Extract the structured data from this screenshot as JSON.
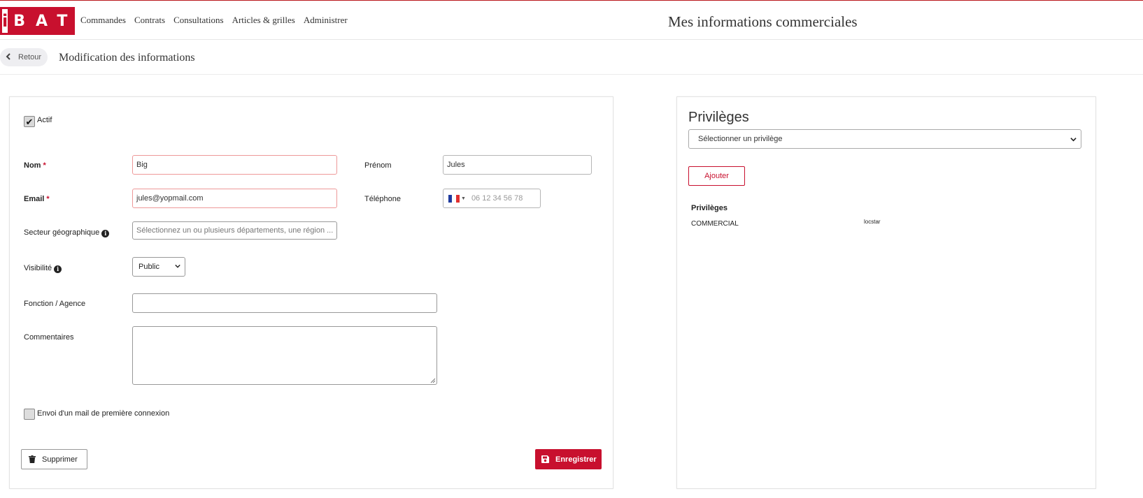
{
  "brand": {
    "logo_first": "i",
    "logo_rest": "BAT",
    "accent": "#c8102e"
  },
  "nav": [
    {
      "label": "Commandes"
    },
    {
      "label": "Contrats"
    },
    {
      "label": "Consultations"
    },
    {
      "label": "Articles & grilles"
    },
    {
      "label": "Administrer"
    }
  ],
  "header": {
    "title": "Mes informations commerciales"
  },
  "subheader": {
    "back_label": "Retour",
    "title": "Modification des informations"
  },
  "form": {
    "active_label": "Actif",
    "active_checked": true,
    "nom": {
      "label": "Nom",
      "required": "*",
      "value": "Big"
    },
    "prenom": {
      "label": "Prénom",
      "value": "Jules"
    },
    "email": {
      "label": "Email",
      "required": "*",
      "value": "jules@yopmail.com"
    },
    "telephone": {
      "label": "Téléphone",
      "placeholder": "06 12 34 56 78",
      "flag": "FR"
    },
    "secteur": {
      "label": "Secteur géographique",
      "placeholder": "Sélectionnez un ou plusieurs départements, une région ..."
    },
    "visibilite": {
      "label": "Visibilité",
      "value": "Public"
    },
    "fonction": {
      "label": "Fonction / Agence",
      "value": ""
    },
    "commentaires": {
      "label": "Commentaires",
      "value": ""
    },
    "mail_label": "Envoi d'un mail de première connexion",
    "mail_checked": false,
    "delete_label": "Supprimer",
    "save_label": "Enregistrer"
  },
  "privileges": {
    "title": "Privilèges",
    "select_placeholder": "Sélectionner un privilège",
    "add_label": "Ajouter",
    "table_header": "Privilèges",
    "rows": [
      {
        "name": "COMMERCIAL",
        "value": "locstar"
      }
    ]
  }
}
